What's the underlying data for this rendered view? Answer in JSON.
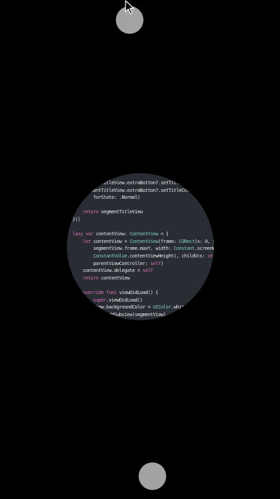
{
  "colors": {
    "background": "#000000",
    "handle": "#a3a3a3",
    "lens_background": "#292c33",
    "keyword": "#d66fb1",
    "type": "#7fd0c2",
    "string": "#ee6a5a",
    "plain": "#e6e6e6"
  },
  "icons": {
    "cursor": "arrow-cursor-icon"
  },
  "code_lines": [
    [
      {
        "t": "    segmentTitleView.extraButton?.setTitle(",
        "c": "pl"
      },
      {
        "t": "\"编辑\"",
        "c": "st"
      },
      {
        "t": ", for",
        "c": "pl"
      }
    ],
    [
      {
        "t": "    segmentTitleView.extraButton?.setTitleColor(",
        "c": "pl"
      },
      {
        "t": "UIColor.r",
        "c": "ty"
      }
    ],
    [
      {
        "t": "        forState: .Normal)",
        "c": "pl"
      }
    ],
    [],
    [
      {
        "t": "    ",
        "c": "pl"
      },
      {
        "t": "return",
        "c": "kw"
      },
      {
        "t": " segmentTitleView",
        "c": "pl"
      }
    ],
    [
      {
        "t": "}()",
        "c": "pl"
      }
    ],
    [],
    [
      {
        "t": "lazy var",
        "c": "kw"
      },
      {
        "t": " contentView: ",
        "c": "pl"
      },
      {
        "t": "ContentView",
        "c": "ty"
      },
      {
        "t": " = {",
        "c": "pl"
      }
    ],
    [
      {
        "t": "    ",
        "c": "pl"
      },
      {
        "t": "let",
        "c": "kw"
      },
      {
        "t": " contentView = ",
        "c": "pl"
      },
      {
        "t": "ContentView",
        "c": "ty"
      },
      {
        "t": "(frame: ",
        "c": "pl"
      },
      {
        "t": "CGRect",
        "c": "ty"
      },
      {
        "t": "(x: 0, y: ",
        "c": "pl"
      },
      {
        "t": "self",
        "c": "kw"
      },
      {
        "t": ".",
        "c": "pl"
      }
    ],
    [
      {
        "t": "        segmentView.frame.maxY, width: ",
        "c": "pl"
      },
      {
        "t": "Constant",
        "c": "ty"
      },
      {
        "t": ".screenWidth, height:",
        "c": "pl"
      }
    ],
    [
      {
        "t": "        ",
        "c": "pl"
      },
      {
        "t": "ConstantValue",
        "c": "ty"
      },
      {
        "t": ".contentViewHeight), childVcs: ",
        "c": "pl"
      },
      {
        "t": "self",
        "c": "kw"
      },
      {
        "t": ".childVcs,",
        "c": "pl"
      }
    ],
    [
      {
        "t": "        parentViewController: ",
        "c": "pl"
      },
      {
        "t": "self",
        "c": "kw"
      },
      {
        "t": ")",
        "c": "pl"
      }
    ],
    [
      {
        "t": "    contentView.delegate = ",
        "c": "pl"
      },
      {
        "t": "self",
        "c": "kw"
      }
    ],
    [
      {
        "t": "    ",
        "c": "pl"
      },
      {
        "t": "return",
        "c": "kw"
      },
      {
        "t": " contentView",
        "c": "pl"
      }
    ],
    [],
    [
      {
        "t": "    override func",
        "c": "kw"
      },
      {
        "t": " viewDidLoad() {",
        "c": "pl"
      }
    ],
    [
      {
        "t": "        ",
        "c": "pl"
      },
      {
        "t": "super",
        "c": "kw"
      },
      {
        "t": ".viewDidLoad()",
        "c": "pl"
      }
    ],
    [
      {
        "t": "        view.backgroundColor = ",
        "c": "pl"
      },
      {
        "t": "UIColor",
        "c": "ty"
      },
      {
        "t": ".whiteColor()",
        "c": "pl"
      }
    ],
    [
      {
        "t": "        view.addSubview(",
        "c": "pl"
      },
      {
        "t": "segmentView",
        "c": "pl"
      },
      {
        "t": ")",
        "c": "pl"
      }
    ]
  ]
}
